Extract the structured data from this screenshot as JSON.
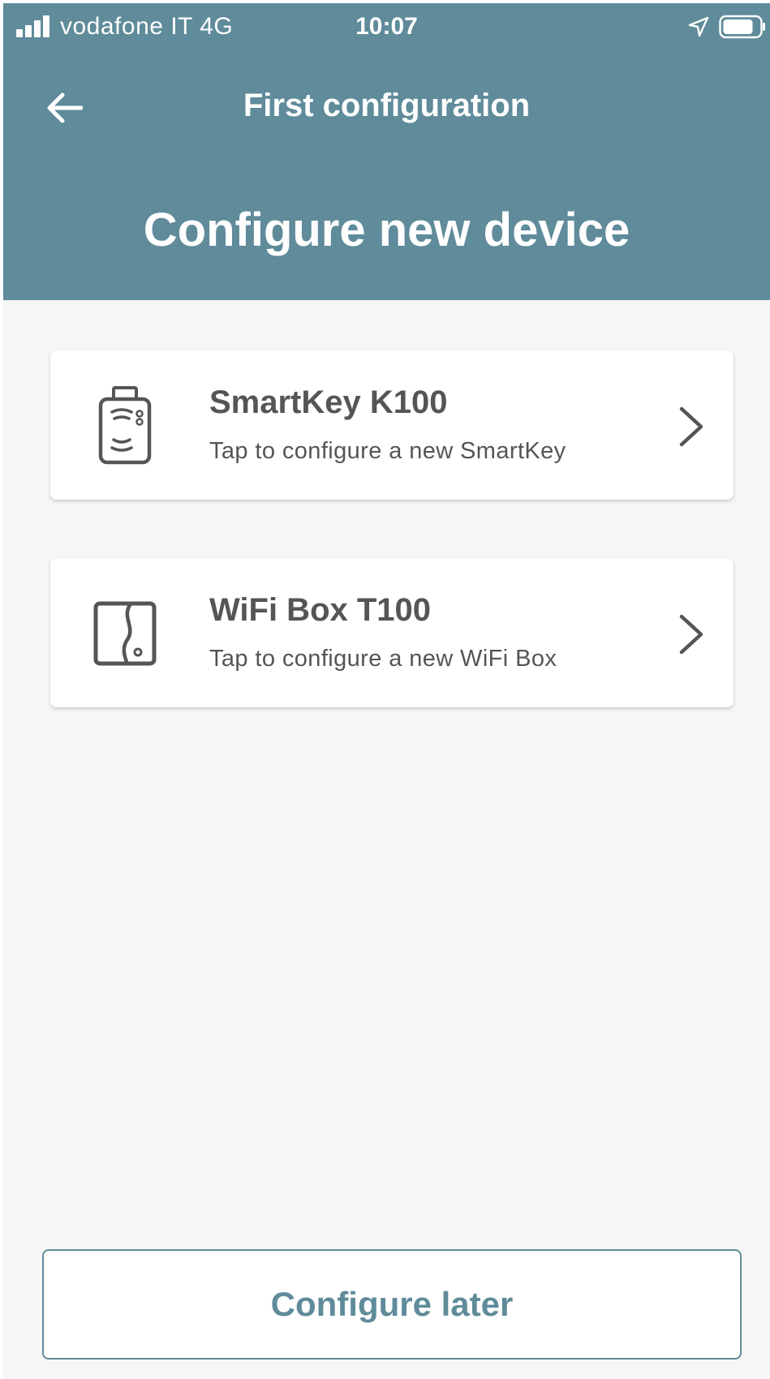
{
  "status_bar": {
    "carrier": "vodafone IT   4G",
    "time": "10:07",
    "icons": [
      "signal-icon",
      "location-arrow-icon",
      "battery-icon"
    ]
  },
  "header": {
    "back_icon": "arrow-left-icon",
    "nav_title": "First configuration",
    "page_title": "Configure new device"
  },
  "devices": [
    {
      "title": "SmartKey K100",
      "subtitle": "Tap to configure a new SmartKey",
      "icon": "smartkey-icon"
    },
    {
      "title": "WiFi Box T100",
      "subtitle": "Tap to configure a new WiFi Box",
      "icon": "wifi-box-icon"
    }
  ],
  "footer": {
    "configure_later_label": "Configure later"
  },
  "colors": {
    "header_bg": "#5f8b9a",
    "screen_bg": "#f6f6f6",
    "card_text": "#555555",
    "accent": "#5f8b9a"
  }
}
